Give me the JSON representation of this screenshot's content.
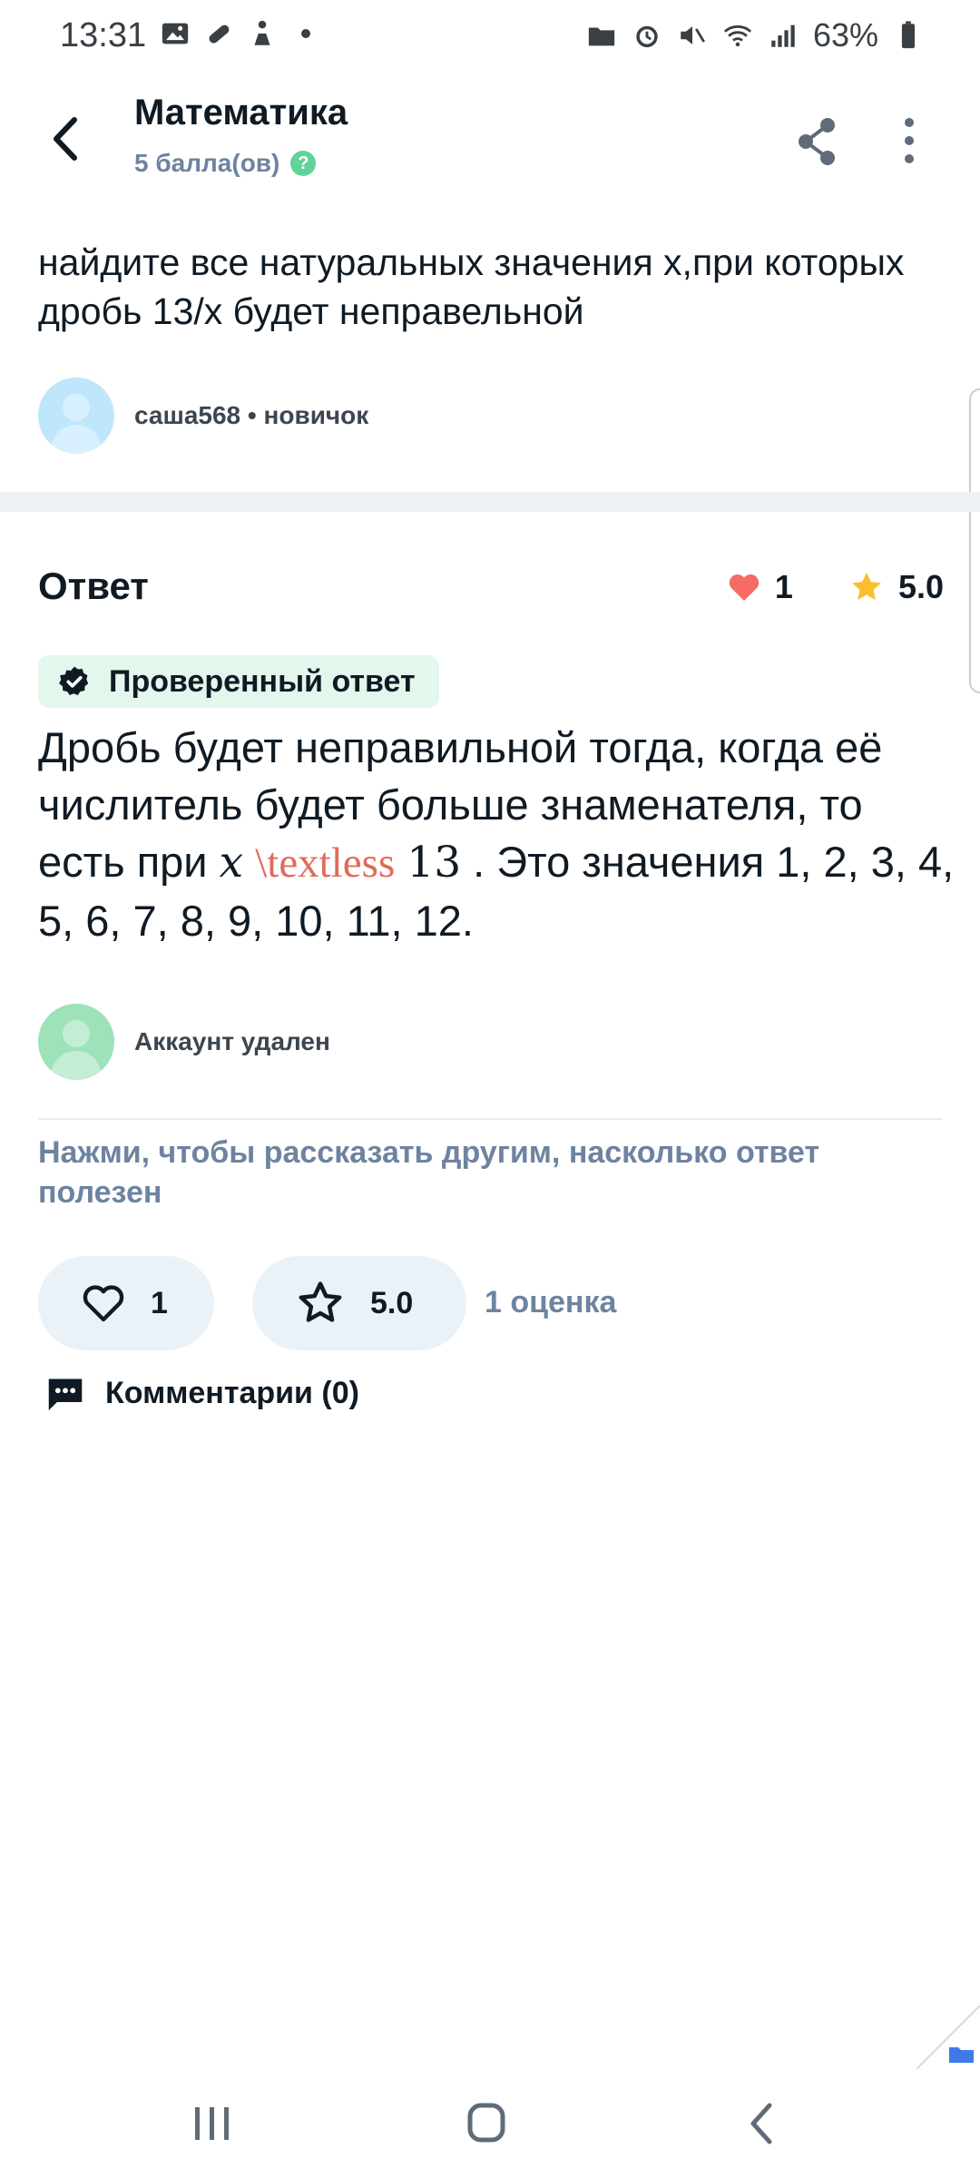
{
  "status_bar": {
    "time": "13:31",
    "battery": "63%"
  },
  "header": {
    "title": "Математика",
    "points": "5 балла(ов)",
    "help_symbol": "?"
  },
  "question": {
    "text": "найдите все натуральных значения х,при которых дробь 13/х будет неправельной",
    "author": "саша568 • новичок"
  },
  "answer": {
    "title": "Ответ",
    "likes": "1",
    "rating": "5.0",
    "verified_label": "Проверенный ответ",
    "text_before": "Дробь будет неправильной тогда, когда её числитель будет больше знаменателя, то есть при ",
    "math_var": "x",
    "math_error": "\\textless",
    "math_num": "13",
    "text_after": " . Это значения 1, 2, 3, 4, 5, 6, 7, 8, 9, 10, 11, 12.",
    "author": "Аккаунт удален"
  },
  "feedback": {
    "prompt": "Нажми, чтобы рассказать другим, насколько ответ полезен",
    "like_count": "1",
    "rating_value": "5.0",
    "rating_count": "1 оценка",
    "comments_label": "Комментарии (0)"
  },
  "colors": {
    "accent_green": "#60d399",
    "heart_red": "#f46c63",
    "star_yellow": "#fbbe2e",
    "muted_blue": "#6d83a0"
  },
  "icons": [
    "back-arrow-icon",
    "share-icon",
    "more-vert-icon",
    "help-icon",
    "heart-icon",
    "star-icon",
    "verified-icon",
    "heart-outline-icon",
    "star-outline-icon",
    "comment-icon"
  ]
}
